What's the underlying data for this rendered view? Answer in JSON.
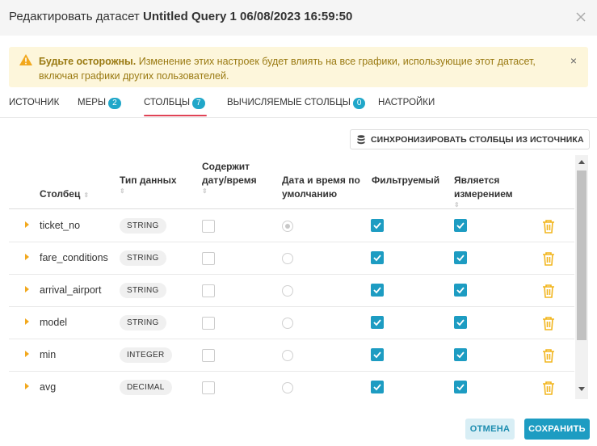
{
  "header": {
    "title_prefix": "Редактировать датасет",
    "dataset_name": "Untitled Query 1 06/08/2023 16:59:50"
  },
  "alert": {
    "bold": "Будьте осторожны.",
    "text": "Изменение этих настроек будет влиять на все графики, использующие этот датасет, включая графики других пользователей.",
    "close": "×"
  },
  "tabs": [
    {
      "label": "ИСТОЧНИК",
      "badge": null
    },
    {
      "label": "МЕРЫ",
      "badge": "2"
    },
    {
      "label": "СТОЛБЦЫ",
      "badge": "7"
    },
    {
      "label": "ВЫЧИСЛЯЕМЫЕ СТОЛБЦЫ",
      "badge": "0"
    },
    {
      "label": "НАСТРОЙКИ",
      "badge": null
    }
  ],
  "active_tab": "СТОЛБЦЫ",
  "sync_button": "СИНХРОНИЗИРОВАТЬ СТОЛБЦЫ ИЗ ИСТОЧНИКА",
  "table": {
    "headers": {
      "column": "Столбец",
      "data_type": "Тип данных",
      "has_datetime_l1": "Содержит",
      "has_datetime_l2": "дату/время",
      "default_datetime_l1": "Дата и время по",
      "default_datetime_l2": "умолчанию",
      "filterable": "Фильтруемый",
      "is_dimension_l1": "Является",
      "is_dimension_l2": "измерением"
    },
    "rows": [
      {
        "name": "ticket_no",
        "type": "STRING",
        "has_datetime": false,
        "default_datetime": true,
        "filterable": true,
        "dimension": true
      },
      {
        "name": "fare_conditions",
        "type": "STRING",
        "has_datetime": false,
        "default_datetime": false,
        "filterable": true,
        "dimension": true
      },
      {
        "name": "arrival_airport",
        "type": "STRING",
        "has_datetime": false,
        "default_datetime": false,
        "filterable": true,
        "dimension": true
      },
      {
        "name": "model",
        "type": "STRING",
        "has_datetime": false,
        "default_datetime": false,
        "filterable": true,
        "dimension": true
      },
      {
        "name": "min",
        "type": "INTEGER",
        "has_datetime": false,
        "default_datetime": false,
        "filterable": true,
        "dimension": true
      },
      {
        "name": "avg",
        "type": "DECIMAL",
        "has_datetime": false,
        "default_datetime": false,
        "filterable": true,
        "dimension": true
      }
    ]
  },
  "footer": {
    "cancel": "ОТМЕНА",
    "save": "СОХРАНИТЬ"
  },
  "colors": {
    "accent": "#1d9cc2",
    "warning_bg": "#fdf6db",
    "warning_text": "#9a7a12",
    "trash": "#f2b51d",
    "tab_underline": "#e04355"
  }
}
